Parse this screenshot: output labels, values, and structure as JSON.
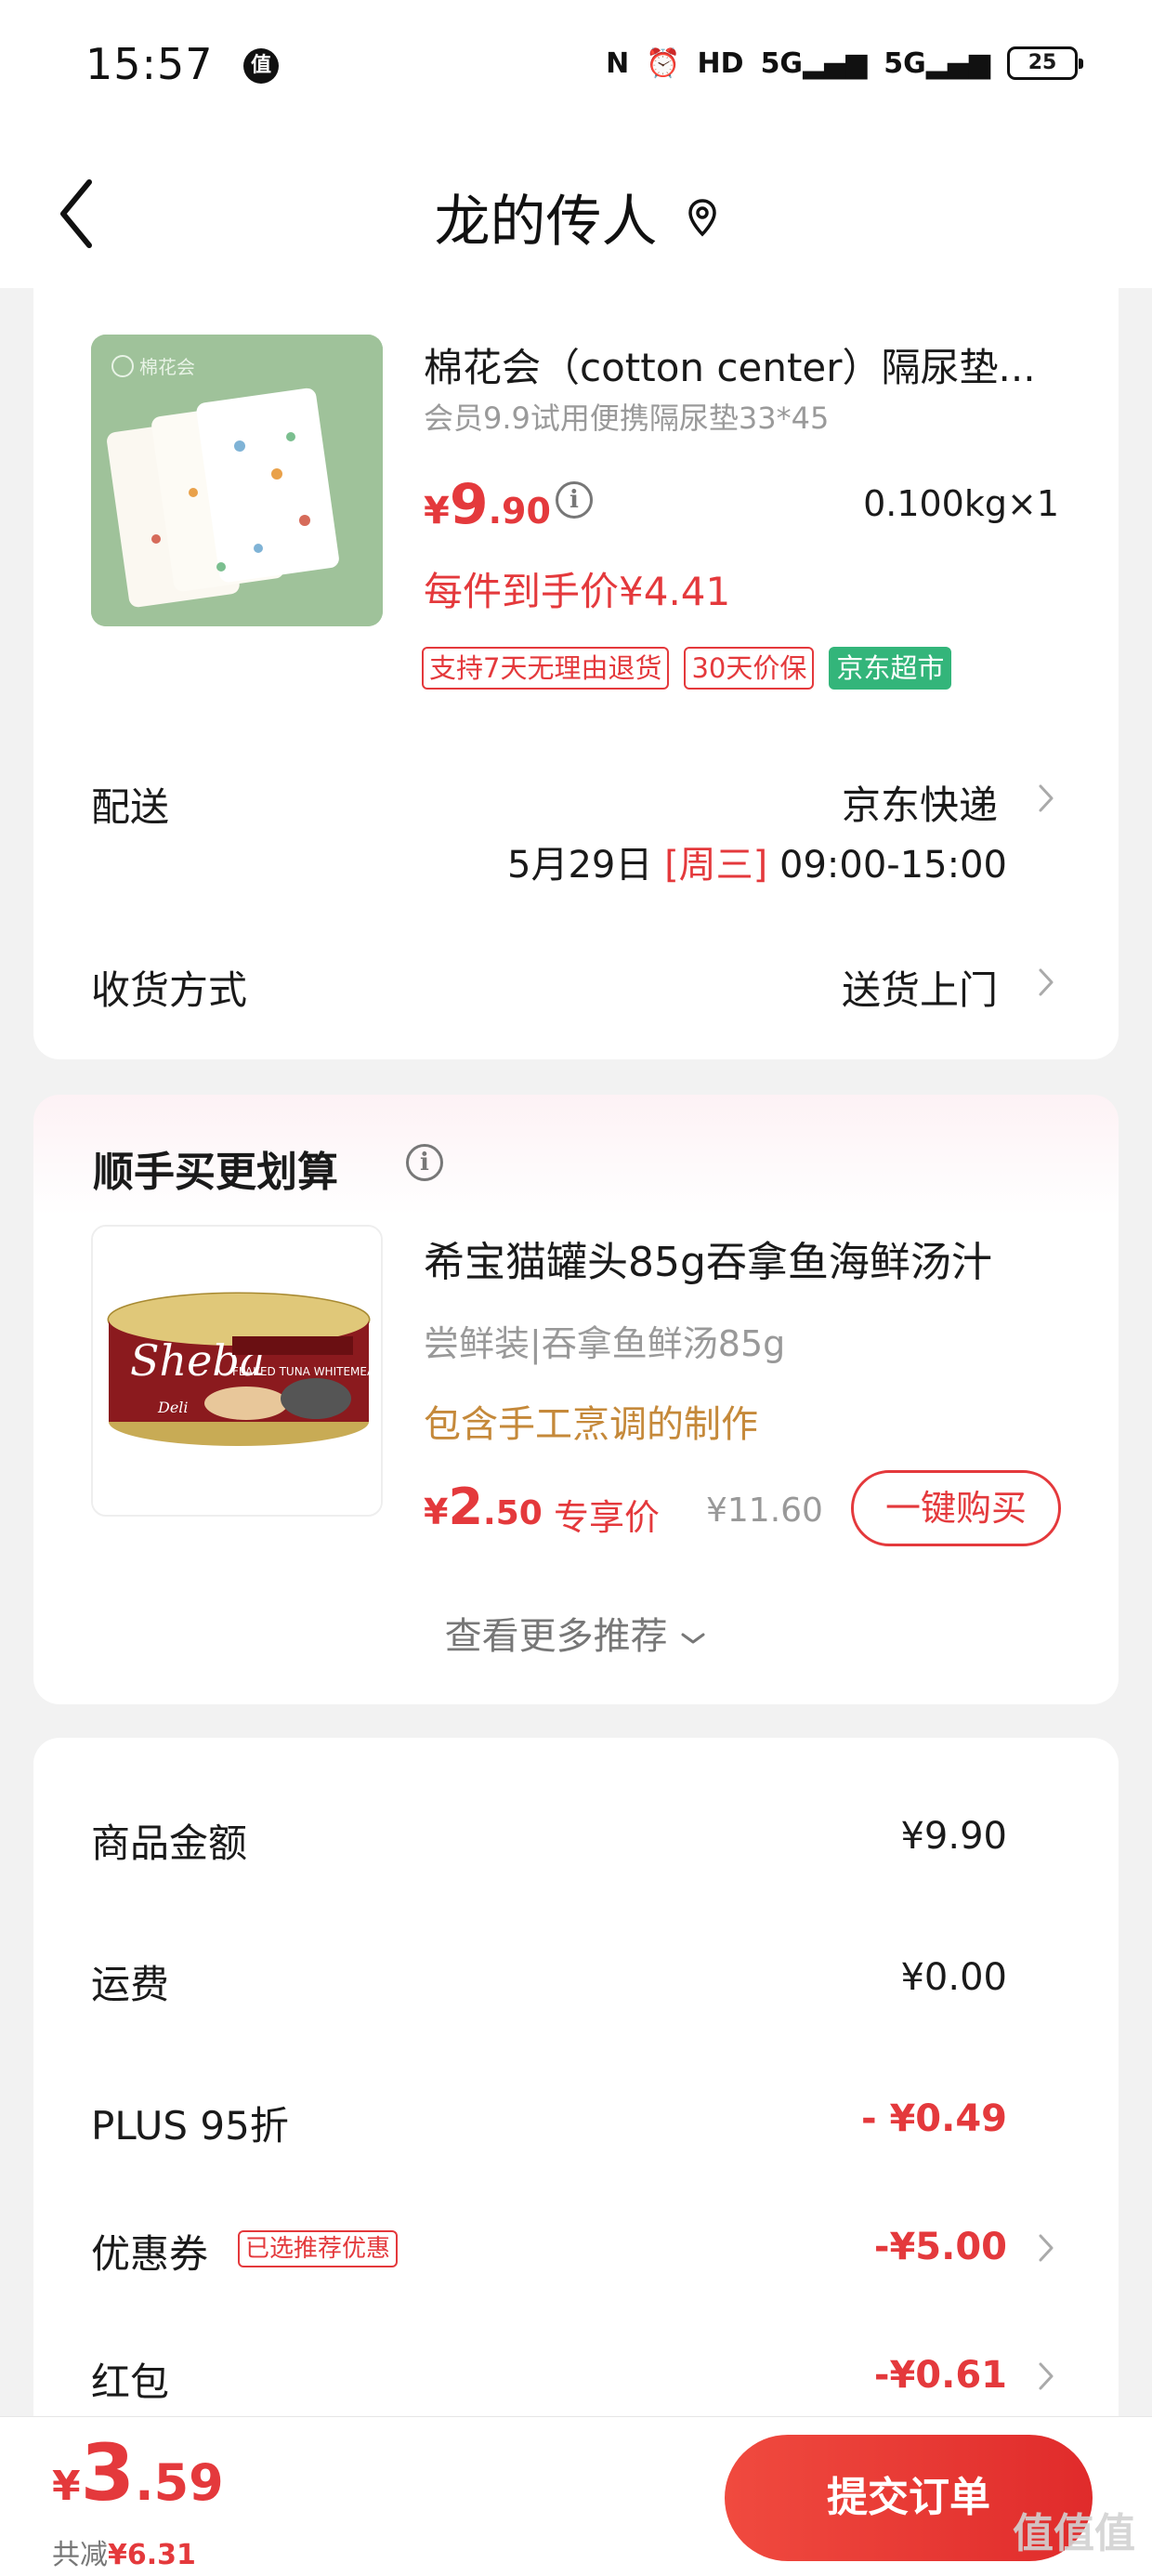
{
  "status_bar": {
    "time": "15:57",
    "badge": "值",
    "icons": [
      "N",
      "⏰",
      "HD",
      "5G",
      "5G"
    ],
    "battery": "25"
  },
  "header": {
    "title": "龙的传人"
  },
  "product": {
    "image_brand": "棉花会",
    "name": "棉花会（cotton center）隔尿垫...",
    "subtitle": "会员9.9试用便携隔尿垫33*45",
    "price_symbol": "¥",
    "price_int": "9",
    "price_dec": ".90",
    "weight": "0.100kg×1",
    "final_price": "每件到手价¥4.41",
    "tags": [
      "支持7天无理由退货",
      "30天价保",
      "京东超市"
    ]
  },
  "delivery": {
    "label": "配送",
    "value": "京东快递",
    "date": "5月29日",
    "weekday": "[周三]",
    "time_range": "09:00-15:00"
  },
  "receive": {
    "label": "收货方式",
    "value": "送货上门"
  },
  "recommend": {
    "title": "顺手买更划算",
    "name": "希宝猫罐头85g吞拿鱼海鲜汤汁",
    "subtitle": "尝鲜装|吞拿鱼鲜汤85g",
    "feature": "包含手工烹调的制作",
    "price_symbol": "¥",
    "price_int": "2",
    "price_dec": ".50",
    "exclusive_label": "专享价",
    "original_price": "¥11.60",
    "buy_button": "一键购买",
    "see_more": "查看更多推荐",
    "can_brand": "Sheba",
    "can_line": "FLAKED TUNA WHITEMEAT",
    "can_sub": "Deli"
  },
  "summary": {
    "goods_amount_label": "商品金额",
    "goods_amount": "¥9.90",
    "shipping_label": "运费",
    "shipping": "¥0.00",
    "plus_label": "PLUS 95折",
    "plus_discount": "- ¥0.49",
    "coupon_label": "优惠券",
    "coupon_tag": "已选推荐优惠",
    "coupon_discount": "-¥5.00",
    "redpacket_label": "红包",
    "redpacket_discount": "-¥0.61"
  },
  "bottom": {
    "total_symbol": "¥",
    "total_int": "3",
    "total_dec": ".59",
    "saved_label": "共减",
    "saved_amount": "¥6.31",
    "submit": "提交订单",
    "watermark": "值值值"
  },
  "colors": {
    "accent_red": "#e4393c",
    "green_tag": "#33b57a",
    "feature_gold": "#c5893a"
  }
}
